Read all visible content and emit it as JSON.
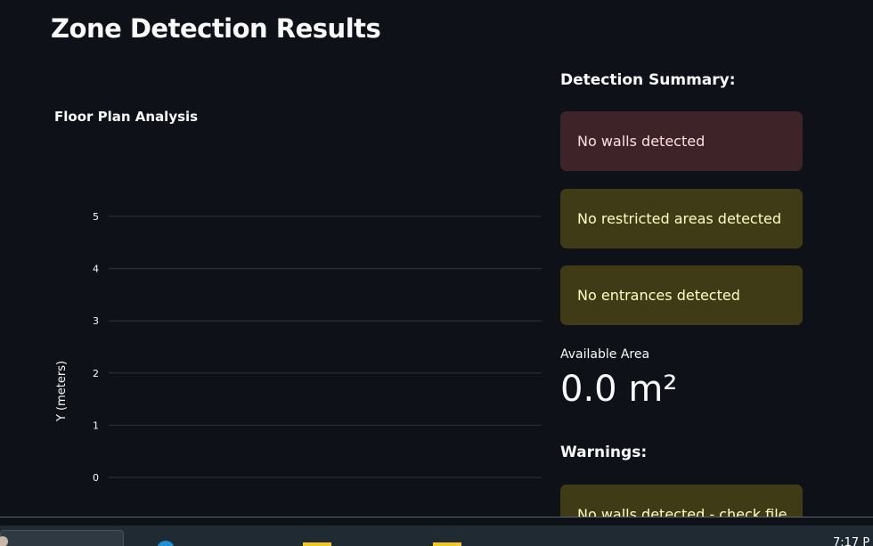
{
  "page": {
    "title": "Zone Detection Results"
  },
  "chart_data": {
    "type": "line",
    "title": "Floor Plan Analysis",
    "ylabel": "Y (meters)",
    "xlabel": "",
    "yticks": [
      0,
      1,
      2,
      3,
      4,
      5
    ],
    "ylim": [
      -0.4,
      5.6
    ],
    "grid": true,
    "series": []
  },
  "summary": {
    "heading": "Detection Summary:",
    "alerts": [
      {
        "text": "No walls detected",
        "kind": "error"
      },
      {
        "text": "No restricted areas detected",
        "kind": "warning"
      },
      {
        "text": "No entrances detected",
        "kind": "warning"
      }
    ]
  },
  "metric": {
    "label": "Available Area",
    "value": "0.0 m²"
  },
  "warnings": {
    "heading": "Warnings:",
    "items": [
      {
        "text": "No walls detected - check file"
      }
    ]
  },
  "taskbar": {
    "clock": "7:17 P"
  },
  "colors": {
    "background": "#0e1117",
    "error_bg": "#3e2428",
    "error_text": "#ffdede",
    "warning_bg": "#3e3b16",
    "warning_text": "#ffffc2",
    "gridline": "#31333f"
  }
}
